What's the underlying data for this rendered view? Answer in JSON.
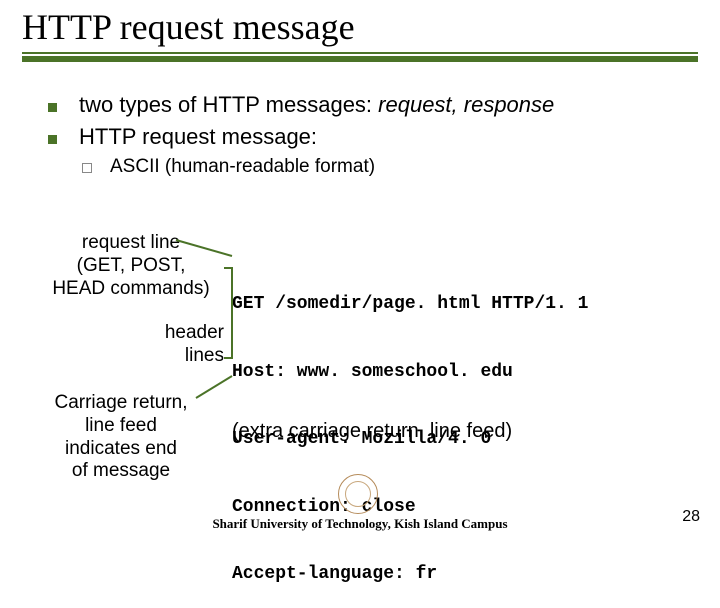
{
  "title": "HTTP request message",
  "bullets": {
    "b1_pre": "two types of HTTP messages: ",
    "b1_em": "request, response",
    "b2": "HTTP request message:",
    "sub1": "ASCII (human-readable format)"
  },
  "labels": {
    "request_line": "request line\n(GET, POST,\nHEAD commands)",
    "header_lines": "header\nlines",
    "crlf": "Carriage return,\nline feed\nindicates end\nof message"
  },
  "code": {
    "l1": "GET /somedir/page. html HTTP/1. 1",
    "l2": "Host: www. someschool. edu",
    "l3": "User-agent: Mozilla/4. 0",
    "l4": "Connection: close",
    "l5": "Accept-language: fr"
  },
  "extra": "(extra carriage return, line feed)",
  "footer": "Sharif University of Technology, Kish Island Campus",
  "page": "28"
}
